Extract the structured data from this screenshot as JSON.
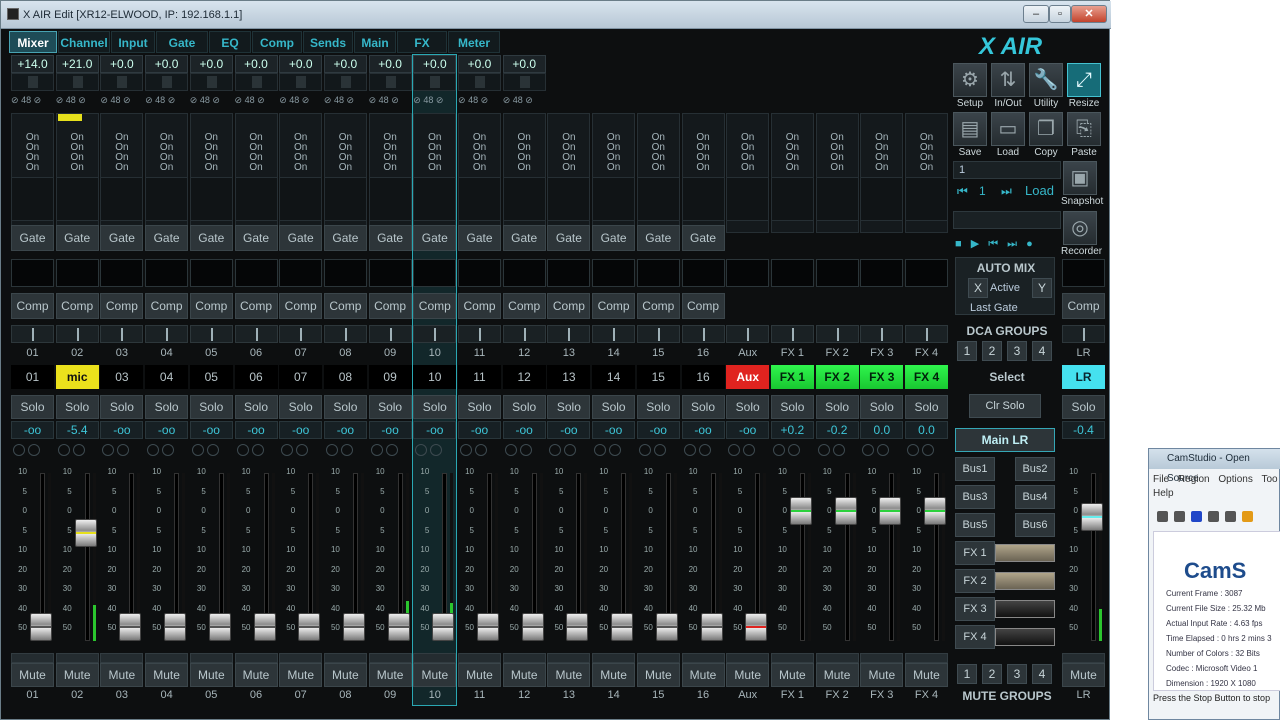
{
  "window": {
    "title": "X AIR Edit [XR12-ELWOOD, IP: 192.168.1.1]",
    "min": "–",
    "max": "▫",
    "close": "✕"
  },
  "tabs": [
    "Mixer",
    "Channel",
    "Input",
    "Gate",
    "EQ",
    "Comp",
    "Sends",
    "Main",
    "FX",
    "Meter"
  ],
  "active_tab": "Mixer",
  "channel_common": {
    "on_labels": [
      "On",
      "On",
      "On",
      "On"
    ],
    "gate_label": "Gate",
    "comp_label": "Comp",
    "solo_label": "Solo",
    "mute_label": "Mute",
    "link_value": "48"
  },
  "channels": [
    {
      "num": "01",
      "name": "01",
      "gain": "+14.0",
      "level": "-oo"
    },
    {
      "num": "02",
      "name": "mic",
      "gain": "+21.0",
      "level": "-5.4"
    },
    {
      "num": "03",
      "name": "03",
      "gain": "+0.0",
      "level": "-oo"
    },
    {
      "num": "04",
      "name": "04",
      "gain": "+0.0",
      "level": "-oo"
    },
    {
      "num": "05",
      "name": "05",
      "gain": "+0.0",
      "level": "-oo"
    },
    {
      "num": "06",
      "name": "06",
      "gain": "+0.0",
      "level": "-oo"
    },
    {
      "num": "07",
      "name": "07",
      "gain": "+0.0",
      "level": "-oo"
    },
    {
      "num": "08",
      "name": "08",
      "gain": "+0.0",
      "level": "-oo"
    },
    {
      "num": "09",
      "name": "09",
      "gain": "+0.0",
      "level": "-oo"
    },
    {
      "num": "10",
      "name": "10",
      "gain": "+0.0",
      "level": "-oo"
    },
    {
      "num": "11",
      "name": "11",
      "gain": "+0.0",
      "level": "-oo"
    },
    {
      "num": "12",
      "name": "12",
      "gain": "+0.0",
      "level": "-oo"
    },
    {
      "num": "13",
      "name": "13",
      "level": "-oo"
    },
    {
      "num": "14",
      "name": "14",
      "level": "-oo"
    },
    {
      "num": "15",
      "name": "15",
      "level": "-oo"
    },
    {
      "num": "16",
      "name": "16",
      "level": "-oo"
    },
    {
      "num": "Aux",
      "name": "Aux",
      "level": "-oo"
    },
    {
      "num": "FX 1",
      "name": "FX 1",
      "level": "+0.2"
    },
    {
      "num": "FX 2",
      "name": "FX 2",
      "level": "-0.2"
    },
    {
      "num": "FX 3",
      "name": "FX 3",
      "level": "0.0"
    },
    {
      "num": "FX 4",
      "name": "FX 4",
      "level": "0.0"
    }
  ],
  "lr": {
    "num": "LR",
    "name": "LR",
    "level": "-0.4",
    "comp_label": "Comp",
    "solo_label": "Solo",
    "mute_label": "Mute"
  },
  "fader_scale": [
    "10",
    "5",
    "0",
    "5",
    "10",
    "20",
    "30",
    "40",
    "50"
  ],
  "right_panel": {
    "logo": "X AIR",
    "buttons_row1": [
      "Setup",
      "In/Out",
      "Utility",
      "Resize"
    ],
    "buttons_row2": [
      "Save",
      "Load",
      "Copy",
      "Paste"
    ],
    "snapshot_label": "Snapshot",
    "recorder_label": "Recorder",
    "scene_number": "1",
    "scene_nav_number": "1",
    "load_label": "Load",
    "automix_title": "AUTO MIX",
    "automix_x": "X",
    "automix_active": "Active",
    "automix_y": "Y",
    "last_gate": "Last Gate",
    "dca_title": "DCA GROUPS",
    "dca": [
      "1",
      "2",
      "3",
      "4"
    ],
    "select_label": "Select",
    "clr_solo": "Clr Solo",
    "main_lr": "Main LR",
    "buses": [
      "Bus1",
      "Bus2",
      "Bus3",
      "Bus4",
      "Bus5",
      "Bus6"
    ],
    "fx_buttons": [
      "FX 1",
      "FX 2",
      "FX 3",
      "FX 4"
    ],
    "mute_groups": [
      "1",
      "2",
      "3",
      "4"
    ],
    "mute_groups_title": "MUTE GROUPS"
  },
  "camstudio": {
    "title": "CamStudio - Open Source",
    "menu": [
      "File",
      "Region",
      "Options",
      "Too",
      "Help"
    ],
    "logo": "CamS",
    "info": [
      "Current Frame : 3087",
      "Current File Size : 25.32 Mb",
      "Actual Input Rate : 4.63 fps",
      "Time Elapsed : 0 hrs 2 mins 3",
      "Number of Colors : 32 Bits",
      "Codec : Microsoft Video 1",
      "Dimension : 1920 X 1080"
    ],
    "status": "Press the Stop Button to stop"
  },
  "colors": {
    "accent": "#36b7c9",
    "mic": "#ebe11c",
    "aux": "#e0231f",
    "fx": "#2ff54d",
    "lr": "#45e1ef"
  }
}
